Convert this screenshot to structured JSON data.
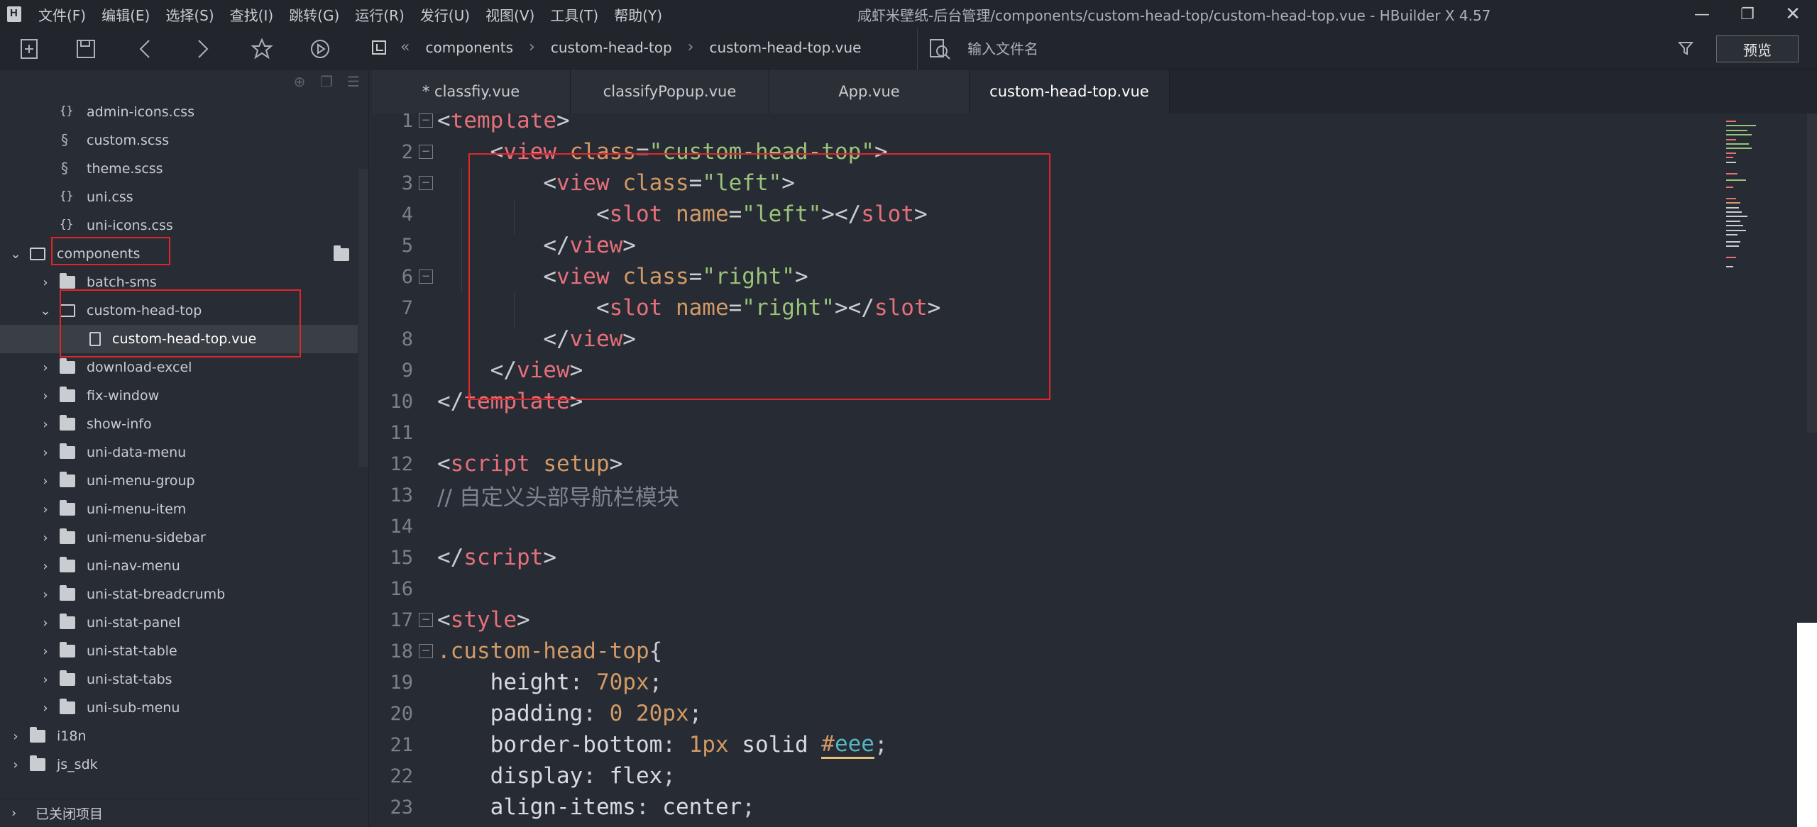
{
  "app": {
    "window_title": "咸虾米壁纸-后台管理/components/custom-head-top/custom-head-top.vue - HBuilder X 4.57",
    "menu": [
      "文件(F)",
      "编辑(E)",
      "选择(S)",
      "查找(I)",
      "跳转(G)",
      "运行(R)",
      "发行(U)",
      "视图(V)",
      "工具(T)",
      "帮助(Y)"
    ]
  },
  "toolbar": {
    "breadcrumb": [
      "components",
      "custom-head-top",
      "custom-head-top.vue"
    ],
    "search_placeholder": "输入文件名",
    "preview_label": "预览"
  },
  "sidebar": {
    "items": [
      {
        "label": "admin-icons.css",
        "icon": "css-file-icon",
        "level": 3
      },
      {
        "label": "custom.scss",
        "icon": "scss-file-icon",
        "level": 3
      },
      {
        "label": "theme.scss",
        "icon": "scss-file-icon",
        "level": 3
      },
      {
        "label": "uni.css",
        "icon": "css-file-icon",
        "level": 3
      },
      {
        "label": "uni-icons.css",
        "icon": "css-file-icon",
        "level": 3
      },
      {
        "label": "components",
        "icon": "folder-open-icon",
        "level": 2,
        "expanded": true
      },
      {
        "label": "batch-sms",
        "icon": "folder-icon",
        "level": 3
      },
      {
        "label": "custom-head-top",
        "icon": "folder-open-icon",
        "level": 3,
        "expanded": true
      },
      {
        "label": "custom-head-top.vue",
        "icon": "vue-file-icon",
        "level": 4,
        "selected": true
      },
      {
        "label": "download-excel",
        "icon": "folder-icon",
        "level": 3
      },
      {
        "label": "fix-window",
        "icon": "folder-icon",
        "level": 3
      },
      {
        "label": "show-info",
        "icon": "folder-icon",
        "level": 3
      },
      {
        "label": "uni-data-menu",
        "icon": "folder-icon",
        "level": 3
      },
      {
        "label": "uni-menu-group",
        "icon": "folder-icon",
        "level": 3
      },
      {
        "label": "uni-menu-item",
        "icon": "folder-icon",
        "level": 3
      },
      {
        "label": "uni-menu-sidebar",
        "icon": "folder-icon",
        "level": 3
      },
      {
        "label": "uni-nav-menu",
        "icon": "folder-icon",
        "level": 3
      },
      {
        "label": "uni-stat-breadcrumb",
        "icon": "folder-icon",
        "level": 3
      },
      {
        "label": "uni-stat-panel",
        "icon": "folder-icon",
        "level": 3
      },
      {
        "label": "uni-stat-table",
        "icon": "folder-icon",
        "level": 3
      },
      {
        "label": "uni-stat-tabs",
        "icon": "folder-icon",
        "level": 3
      },
      {
        "label": "uni-sub-menu",
        "icon": "folder-icon",
        "level": 3
      },
      {
        "label": "i18n",
        "icon": "folder-icon",
        "level": 2
      },
      {
        "label": "js_sdk",
        "icon": "folder-icon",
        "level": 2
      }
    ],
    "closed_projects_label": "已关闭项目"
  },
  "tabs": [
    {
      "label": "* classfiy.vue",
      "active": false
    },
    {
      "label": "classifyPopup.vue",
      "active": false
    },
    {
      "label": "App.vue",
      "active": false
    },
    {
      "label": "custom-head-top.vue",
      "active": true
    }
  ],
  "code": [
    {
      "n": "1",
      "fold": "minus",
      "tokens": [
        [
          "br",
          "<"
        ],
        [
          "tag",
          "template"
        ],
        [
          "br",
          ">"
        ]
      ]
    },
    {
      "n": "2",
      "fold": "minus",
      "tokens": [
        [
          "txt",
          "    "
        ],
        [
          "br",
          "<"
        ],
        [
          "tag",
          "view"
        ],
        [
          "txt",
          " "
        ],
        [
          "attr",
          "class"
        ],
        [
          "br",
          "="
        ],
        [
          "str",
          "\"custom-head-top\""
        ],
        [
          "br",
          ">"
        ]
      ]
    },
    {
      "n": "3",
      "fold": "minus",
      "tokens": [
        [
          "txt",
          "        "
        ],
        [
          "br",
          "<"
        ],
        [
          "tag",
          "view"
        ],
        [
          "txt",
          " "
        ],
        [
          "attr",
          "class"
        ],
        [
          "br",
          "="
        ],
        [
          "str",
          "\"left\""
        ],
        [
          "br",
          ">"
        ]
      ]
    },
    {
      "n": "4",
      "fold": "",
      "tokens": [
        [
          "txt",
          "            "
        ],
        [
          "br",
          "<"
        ],
        [
          "tag",
          "slot"
        ],
        [
          "txt",
          " "
        ],
        [
          "attr",
          "name"
        ],
        [
          "br",
          "="
        ],
        [
          "str",
          "\"left\""
        ],
        [
          "br",
          "></"
        ],
        [
          "tag",
          "slot"
        ],
        [
          "br",
          ">"
        ]
      ]
    },
    {
      "n": "5",
      "fold": "",
      "tokens": [
        [
          "txt",
          "        "
        ],
        [
          "br",
          "</"
        ],
        [
          "tag",
          "view"
        ],
        [
          "br",
          ">"
        ]
      ]
    },
    {
      "n": "6",
      "fold": "minus",
      "tokens": [
        [
          "txt",
          "        "
        ],
        [
          "br",
          "<"
        ],
        [
          "tag",
          "view"
        ],
        [
          "txt",
          " "
        ],
        [
          "attr",
          "class"
        ],
        [
          "br",
          "="
        ],
        [
          "str",
          "\"right\""
        ],
        [
          "br",
          ">"
        ]
      ]
    },
    {
      "n": "7",
      "fold": "",
      "tokens": [
        [
          "txt",
          "            "
        ],
        [
          "br",
          "<"
        ],
        [
          "tag",
          "slot"
        ],
        [
          "txt",
          " "
        ],
        [
          "attr",
          "name"
        ],
        [
          "br",
          "="
        ],
        [
          "str",
          "\"right\""
        ],
        [
          "br",
          "></"
        ],
        [
          "tag",
          "slot"
        ],
        [
          "br",
          ">"
        ]
      ]
    },
    {
      "n": "8",
      "fold": "",
      "tokens": [
        [
          "txt",
          "        "
        ],
        [
          "br",
          "</"
        ],
        [
          "tag",
          "view"
        ],
        [
          "br",
          ">"
        ]
      ]
    },
    {
      "n": "9",
      "fold": "",
      "tokens": [
        [
          "txt",
          "    "
        ],
        [
          "br",
          "</"
        ],
        [
          "tag",
          "view"
        ],
        [
          "br",
          ">"
        ]
      ]
    },
    {
      "n": "10",
      "fold": "",
      "tokens": [
        [
          "br",
          "</"
        ],
        [
          "tag",
          "template"
        ],
        [
          "br",
          ">"
        ]
      ]
    },
    {
      "n": "11",
      "fold": "",
      "tokens": []
    },
    {
      "n": "12",
      "fold": "",
      "tokens": [
        [
          "br",
          "<"
        ],
        [
          "tag",
          "script"
        ],
        [
          "txt",
          " "
        ],
        [
          "attr",
          "setup"
        ],
        [
          "br",
          ">"
        ]
      ]
    },
    {
      "n": "13",
      "fold": "",
      "tokens": [
        [
          "cmt",
          "// 自定义头部导航栏模块"
        ]
      ]
    },
    {
      "n": "14",
      "fold": "",
      "tokens": []
    },
    {
      "n": "15",
      "fold": "",
      "tokens": [
        [
          "br",
          "</"
        ],
        [
          "tag",
          "script"
        ],
        [
          "br",
          ">"
        ]
      ]
    },
    {
      "n": "16",
      "fold": "",
      "tokens": []
    },
    {
      "n": "17",
      "fold": "minus",
      "tokens": [
        [
          "br",
          "<"
        ],
        [
          "tag",
          "style"
        ],
        [
          "br",
          ">"
        ]
      ]
    },
    {
      "n": "18",
      "fold": "minus",
      "tokens": [
        [
          "sel",
          ".custom-head-top"
        ],
        [
          "br",
          "{"
        ]
      ]
    },
    {
      "n": "19",
      "fold": "",
      "tokens": [
        [
          "txt",
          "    "
        ],
        [
          "prop",
          "height"
        ],
        [
          "br",
          ": "
        ],
        [
          "num",
          "70px"
        ],
        [
          "br",
          ";"
        ]
      ]
    },
    {
      "n": "20",
      "fold": "",
      "tokens": [
        [
          "txt",
          "    "
        ],
        [
          "prop",
          "padding"
        ],
        [
          "br",
          ": "
        ],
        [
          "num",
          "0 20px"
        ],
        [
          "br",
          ";"
        ]
      ]
    },
    {
      "n": "21",
      "fold": "",
      "tokens": [
        [
          "txt",
          "    "
        ],
        [
          "prop",
          "border-bottom"
        ],
        [
          "br",
          ": "
        ],
        [
          "num",
          "1px"
        ],
        [
          "prop",
          " solid "
        ],
        [
          "hash",
          "#"
        ],
        [
          "hex",
          "eee"
        ],
        [
          "br",
          ";"
        ]
      ]
    },
    {
      "n": "22",
      "fold": "",
      "tokens": [
        [
          "txt",
          "    "
        ],
        [
          "prop",
          "display"
        ],
        [
          "br",
          ": "
        ],
        [
          "prop",
          "flex"
        ],
        [
          "br",
          ";"
        ]
      ]
    },
    {
      "n": "23",
      "fold": "",
      "tokens": [
        [
          "txt",
          "    "
        ],
        [
          "prop",
          "align-items"
        ],
        [
          "br",
          ": "
        ],
        [
          "prop",
          "center"
        ],
        [
          "br",
          ";"
        ]
      ]
    }
  ],
  "colors": {
    "highlight_box": "#e0262b",
    "editor_bg": "#272b33",
    "tag": "#e5707a",
    "string": "#98c379",
    "attribute": "#d19a66"
  }
}
